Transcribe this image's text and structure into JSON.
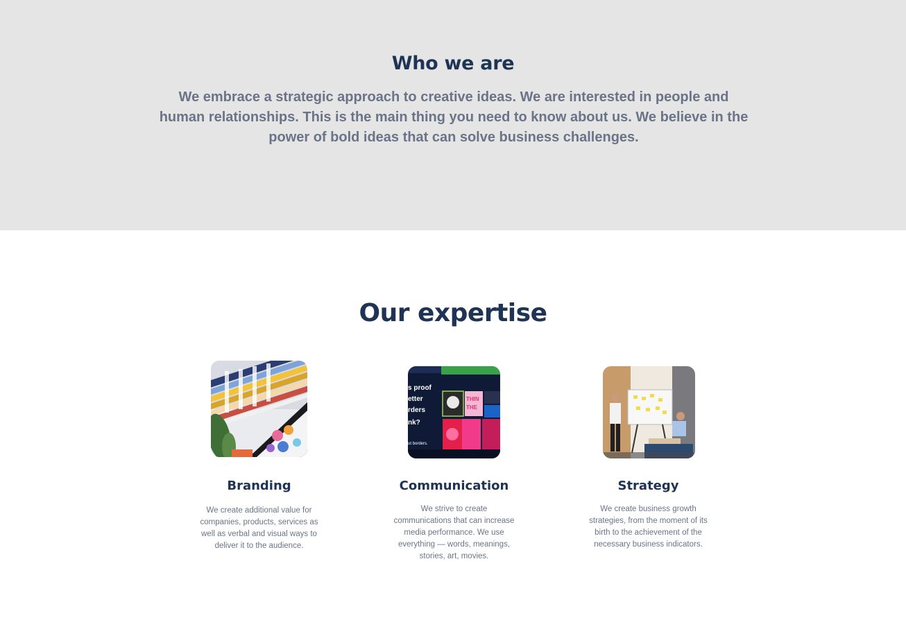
{
  "who": {
    "title": "Who we are",
    "body": "We embrace a strategic approach to creative ideas. We are interested in people and human relationships. This is the main thing you need to know about us. We believe in the power of bold ideas that can solve business challenges."
  },
  "expertise": {
    "title": "Our expertise",
    "cards": [
      {
        "title": "Branding",
        "text": "We create additional value for companies, products, services as well as verbal and visual ways to deliver it to the audience.",
        "image": "color-swatches-photo"
      },
      {
        "title": "Communication",
        "text": "We strive to create communications that can increase media performance. We use everything — words, meanings, stories, art, movies.",
        "image": "poster-wall-photo",
        "image_text": [
          "s proof",
          "etter",
          "rders",
          "nk?",
          "ut borders."
        ]
      },
      {
        "title": "Strategy",
        "text": "We create business growth strategies, from the moment of its birth to the achievement of the necessary business indicators.",
        "image": "team-meeting-photo"
      }
    ]
  }
}
